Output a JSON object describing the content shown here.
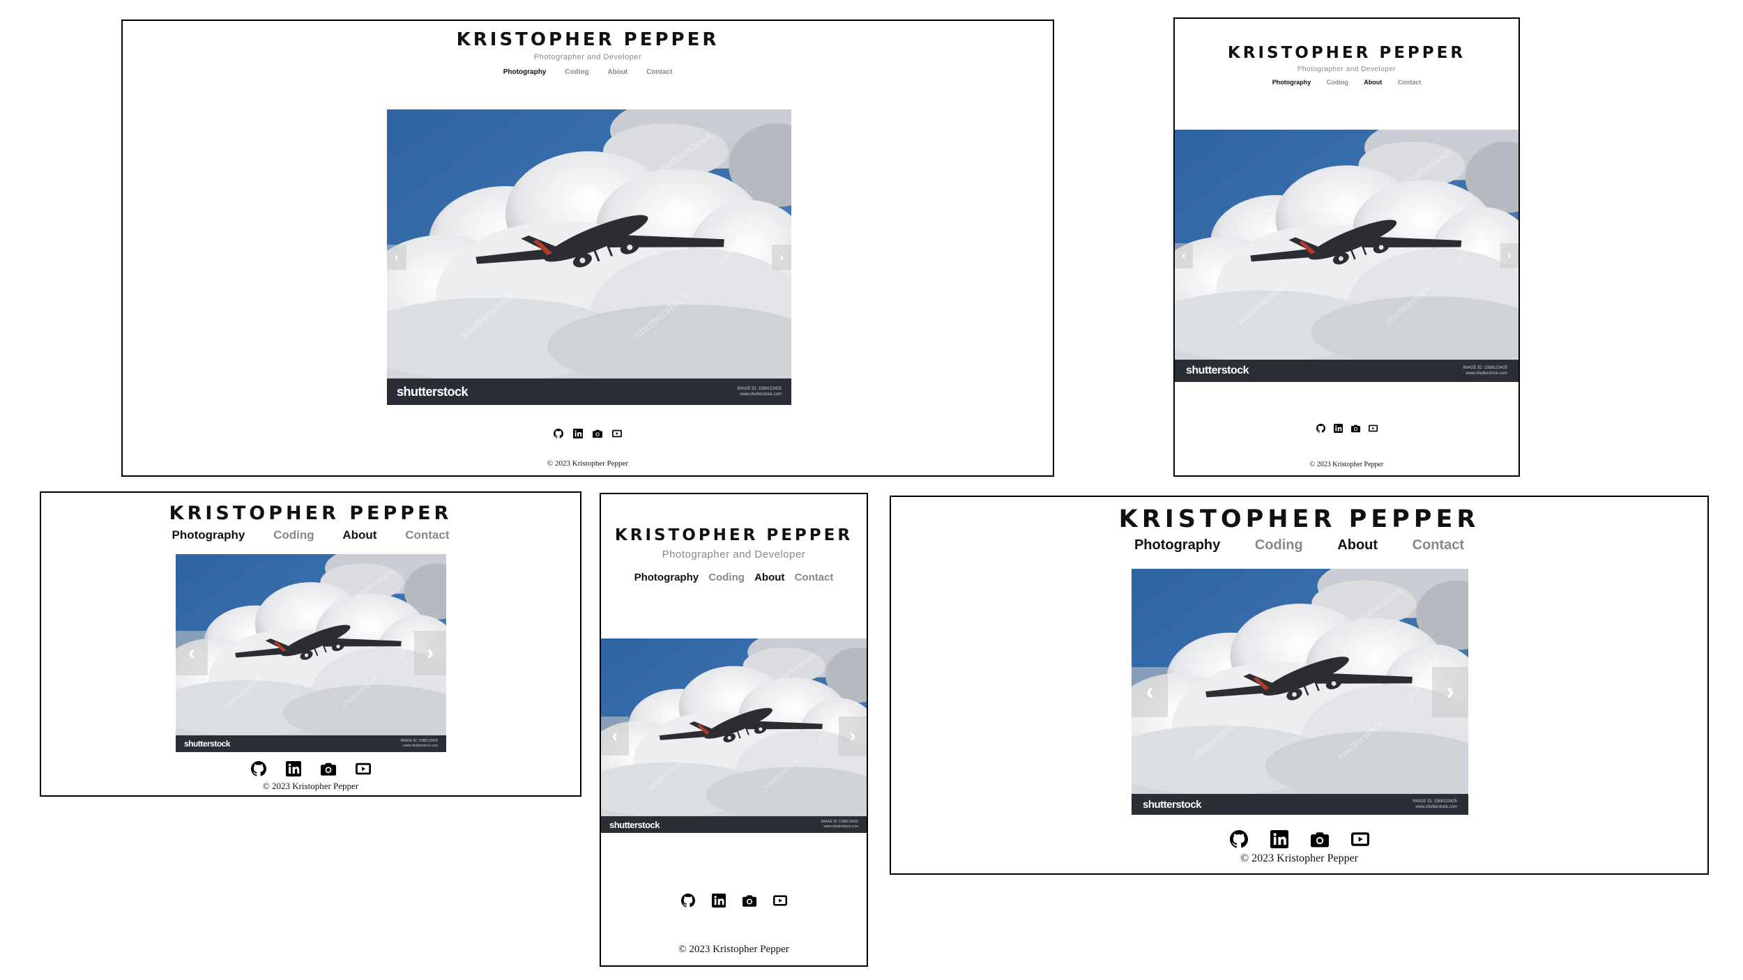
{
  "site": {
    "title": "KRISTOPHER PEPPER",
    "subtitle": "Photographer and Developer",
    "nav": [
      {
        "label": "Photography"
      },
      {
        "label": "Coding"
      },
      {
        "label": "About"
      },
      {
        "label": "Contact"
      }
    ],
    "copyright": "© 2023 Kristopher Pepper",
    "social_icons": [
      "github-icon",
      "linkedin-icon",
      "camera-icon",
      "youtube-icon"
    ]
  },
  "carousel": {
    "prev_glyph": "‹",
    "next_glyph": "›",
    "stock_logo": "shutterstock",
    "stock_id": "IMAGE ID: 1588123425",
    "stock_url": "www.shutterstock.com",
    "watermark": "shutterstock"
  },
  "colors": {
    "sky": "#3a6ea5",
    "cloud": "#f2f2f2",
    "stock_bar": "#2a2e35",
    "nav_active": "#111111",
    "nav_muted": "#888888"
  }
}
